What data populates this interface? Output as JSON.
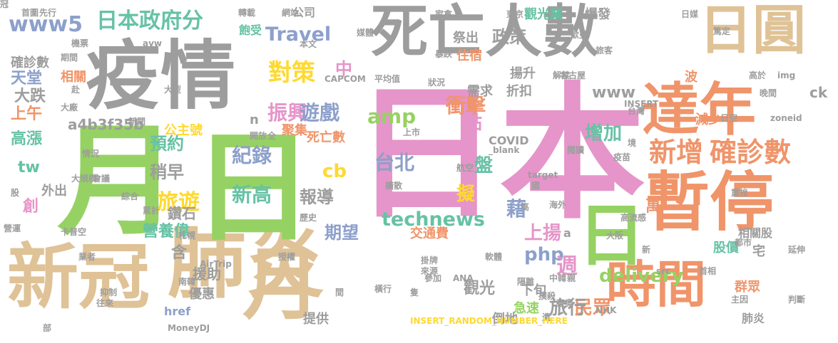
{
  "colors": {
    "tan": "#dfc296",
    "gray": "#9d9d9d",
    "green": "#96d263",
    "pink": "#e595c9",
    "orange": "#f0946a",
    "teal": "#66c2a5",
    "blue": "#8da0cb",
    "yellow": "#ffd92f"
  },
  "words": [
    {
      "text": "日本",
      "size": 1.0,
      "color": "#e595c9"
    },
    {
      "text": "肺炎",
      "size": 0.55,
      "color": "#dfc296"
    },
    {
      "text": "新冠",
      "size": 0.5,
      "color": "#dfc296"
    },
    {
      "text": "疫情",
      "size": 0.52,
      "color": "#9d9d9d"
    },
    {
      "text": "死亡人數",
      "size": 0.45,
      "color": "#9d9d9d"
    },
    {
      "text": "月",
      "size": 0.55,
      "color": "#96d263"
    },
    {
      "text": "日",
      "size": 0.55,
      "color": "#96d263"
    },
    {
      "text": "月",
      "size": 0.55,
      "color": "#dfc296"
    },
    {
      "text": "日圓",
      "size": 0.4,
      "color": "#dfc296"
    },
    {
      "text": "達年",
      "size": 0.42,
      "color": "#f0946a"
    },
    {
      "text": "暫停",
      "size": 0.45,
      "color": "#f0946a"
    },
    {
      "text": "時間",
      "size": 0.32,
      "color": "#f0946a"
    },
    {
      "text": "日",
      "size": 0.35,
      "color": "#96d263"
    },
    {
      "text": "新增",
      "size": 0.2,
      "color": "#f0946a"
    },
    {
      "text": "確診數",
      "size": 0.2,
      "color": "#f0946a"
    },
    {
      "text": "日本政府分",
      "size": 0.16,
      "color": "#66c2a5"
    },
    {
      "text": "www5",
      "size": 0.16,
      "color": "#8da0cb"
    },
    {
      "text": "Travel",
      "size": 0.15,
      "color": "#8da0cb"
    },
    {
      "text": "對策",
      "size": 0.17,
      "color": "#ffd92f"
    },
    {
      "text": "振興",
      "size": 0.14,
      "color": "#e595c9"
    },
    {
      "text": "遊戲",
      "size": 0.13,
      "color": "#8da0cb"
    },
    {
      "text": "衝擊",
      "size": 0.14,
      "color": "#f0946a"
    },
    {
      "text": "政策",
      "size": 0.12,
      "color": "#9d9d9d"
    },
    {
      "text": "amp",
      "size": 0.14,
      "color": "#96d263"
    },
    {
      "text": "台北",
      "size": 0.14,
      "color": "#8da0cb"
    },
    {
      "text": "紀錄",
      "size": 0.14,
      "color": "#8da0cb"
    },
    {
      "text": "新高",
      "size": 0.14,
      "color": "#66c2a5"
    },
    {
      "text": "cb",
      "size": 0.14,
      "color": "#ffd92f"
    },
    {
      "text": "旅遊",
      "size": 0.14,
      "color": "#ffd92f"
    },
    {
      "text": "technews",
      "size": 0.13,
      "color": "#66c2a5"
    },
    {
      "text": "php",
      "size": 0.13,
      "color": "#8da0cb"
    },
    {
      "text": "delivery",
      "size": 0.13,
      "color": "#96d263"
    },
    {
      "text": "www",
      "size": 0.12,
      "color": "#9d9d9d"
    },
    {
      "text": "天堂",
      "size": 0.1,
      "color": "#8da0cb"
    },
    {
      "text": "大跌",
      "size": 0.1,
      "color": "#9d9d9d"
    },
    {
      "text": "上午",
      "size": 0.1,
      "color": "#f0946a"
    },
    {
      "text": "高漲",
      "size": 0.1,
      "color": "#66c2a5"
    },
    {
      "text": "tw",
      "size": 0.12,
      "color": "#66c2a5"
    },
    {
      "text": "預約",
      "size": 0.11,
      "color": "#66c2a5"
    },
    {
      "text": "稍早",
      "size": 0.11,
      "color": "#9d9d9d"
    },
    {
      "text": "公主號",
      "size": 0.09,
      "color": "#ffd92f"
    },
    {
      "text": "鑽石",
      "size": 0.09,
      "color": "#9d9d9d"
    },
    {
      "text": "營養偉",
      "size": 0.1,
      "color": "#66c2a5"
    },
    {
      "text": "報導",
      "size": 0.11,
      "color": "#9d9d9d"
    },
    {
      "text": "期望",
      "size": 0.11,
      "color": "#8da0cb"
    },
    {
      "text": "點",
      "size": 0.11,
      "color": "#e595c9"
    },
    {
      "text": "盤",
      "size": 0.11,
      "color": "#66c2a5"
    },
    {
      "text": "增加",
      "size": 0.11,
      "color": "#66c2a5"
    },
    {
      "text": "上揚",
      "size": 0.11,
      "color": "#e595c9"
    },
    {
      "text": "萬",
      "size": 0.1,
      "color": "#f0946a"
    },
    {
      "text": "週",
      "size": 0.12,
      "color": "#e595c9"
    },
    {
      "text": "民眾",
      "size": 0.11,
      "color": "#f0946a"
    },
    {
      "text": "旅行",
      "size": 0.11,
      "color": "#9d9d9d"
    },
    {
      "text": "藉",
      "size": 0.1,
      "color": "#8da0cb"
    },
    {
      "text": "擬",
      "size": 0.1,
      "color": "#ffd92f"
    },
    {
      "text": "中",
      "size": 0.1,
      "color": "#e595c9"
    },
    {
      "text": "創",
      "size": 0.08,
      "color": "#e595c9"
    },
    {
      "text": "含",
      "size": 0.08,
      "color": "#9d9d9d"
    },
    {
      "text": "援助",
      "size": 0.07,
      "color": "#9d9d9d"
    },
    {
      "text": "優惠",
      "size": 0.06,
      "color": "#9d9d9d"
    },
    {
      "text": "href",
      "size": 0.06,
      "color": "#8da0cb"
    },
    {
      "text": "觀光",
      "size": 0.07,
      "color": "#9d9d9d"
    },
    {
      "text": "下旬",
      "size": 0.06,
      "color": "#9d9d9d"
    },
    {
      "text": "急速",
      "size": 0.06,
      "color": "#96d263"
    },
    {
      "text": "倒地",
      "size": 0.06,
      "color": "#9d9d9d"
    },
    {
      "text": "提供",
      "size": 0.06,
      "color": "#9d9d9d"
    },
    {
      "text": "交通費",
      "size": 0.06,
      "color": "#f0946a"
    },
    {
      "text": "公司",
      "size": 0.05,
      "color": "#9d9d9d"
    },
    {
      "text": "飽受",
      "size": 0.05,
      "color": "#66c2a5"
    },
    {
      "text": "祭出",
      "size": 0.06,
      "color": "#9d9d9d"
    },
    {
      "text": "住宿",
      "size": 0.06,
      "color": "#f0946a"
    },
    {
      "text": "需求",
      "size": 0.06,
      "color": "#9d9d9d"
    },
    {
      "text": "折扣",
      "size": 0.06,
      "color": "#9d9d9d"
    },
    {
      "text": "揚升",
      "size": 0.06,
      "color": "#9d9d9d"
    },
    {
      "text": "觀光業",
      "size": 0.06,
      "color": "#66c2a5"
    },
    {
      "text": "爆發",
      "size": 0.06,
      "color": "#9d9d9d"
    },
    {
      "text": "波",
      "size": 0.06,
      "color": "#f0946a"
    },
    {
      "text": "減少",
      "size": 0.06,
      "color": "#f0946a"
    },
    {
      "text": "股價",
      "size": 0.06,
      "color": "#66c2a5"
    },
    {
      "text": "群眾",
      "size": 0.06,
      "color": "#f0946a"
    },
    {
      "text": "肺炎",
      "size": 0.05,
      "color": "#9d9d9d"
    },
    {
      "text": "相關股",
      "size": 0.05,
      "color": "#9d9d9d"
    },
    {
      "text": "ck",
      "size": 0.06,
      "color": "#9d9d9d"
    },
    {
      "text": "宅",
      "size": 0.06,
      "color": "#9d9d9d"
    },
    {
      "text": "聚集",
      "size": 0.05,
      "color": "#f0946a"
    },
    {
      "text": "死亡數",
      "size": 0.05,
      "color": "#f0946a"
    },
    {
      "text": "COVID",
      "size": 0.05,
      "color": "#9d9d9d"
    },
    {
      "text": "a4b3f35b",
      "size": 0.06,
      "color": "#9d9d9d"
    },
    {
      "text": "n",
      "size": 0.05,
      "color": "#9d9d9d"
    },
    {
      "text": "確診數",
      "size": 0.05,
      "color": "#9d9d9d"
    },
    {
      "text": "相關",
      "size": 0.05,
      "color": "#f0946a"
    },
    {
      "text": "外出",
      "size": 0.05,
      "color": "#9d9d9d"
    },
    {
      "text": "a",
      "size": 0.05,
      "color": "#9d9d9d"
    },
    {
      "text": "首圖",
      "size": 0.03,
      "color": "#9d9d9d"
    },
    {
      "text": "先行",
      "size": 0.03,
      "color": "#9d9d9d"
    },
    {
      "text": "轉載",
      "size": 0.03,
      "color": "#9d9d9d"
    },
    {
      "text": "網站",
      "size": 0.03,
      "color": "#9d9d9d"
    },
    {
      "text": "家禽",
      "size": 0.03,
      "color": "#9d9d9d"
    },
    {
      "text": "東京",
      "size": 0.03,
      "color": "#9d9d9d"
    },
    {
      "text": "日媒",
      "size": 0.03,
      "color": "#9d9d9d"
    },
    {
      "text": "機票",
      "size": 0.03,
      "color": "#9d9d9d"
    },
    {
      "text": "期間",
      "size": 0.03,
      "color": "#9d9d9d"
    },
    {
      "text": "avw",
      "size": 0.03,
      "color": "#9d9d9d"
    },
    {
      "text": "本文",
      "size": 0.03,
      "color": "#9d9d9d"
    },
    {
      "text": "媒體",
      "size": 0.03,
      "color": "#9d9d9d"
    },
    {
      "text": "暴跌",
      "size": 0.03,
      "color": "#9d9d9d"
    },
    {
      "text": "歐亞",
      "size": 0.03,
      "color": "#9d9d9d"
    },
    {
      "text": "篤定",
      "size": 0.03,
      "color": "#9d9d9d"
    },
    {
      "text": "旅客",
      "size": 0.03,
      "color": "#9d9d9d"
    },
    {
      "text": "赴",
      "size": 0.03,
      "color": "#9d9d9d"
    },
    {
      "text": "大型",
      "size": 0.03,
      "color": "#9d9d9d"
    },
    {
      "text": "大廠",
      "size": 0.03,
      "color": "#9d9d9d"
    },
    {
      "text": "新聞",
      "size": 0.03,
      "color": "#9d9d9d"
    },
    {
      "text": "CAPCOM",
      "size": 0.03,
      "color": "#9d9d9d"
    },
    {
      "text": "平均值",
      "size": 0.03,
      "color": "#9d9d9d"
    },
    {
      "text": "狀況",
      "size": 0.03,
      "color": "#9d9d9d"
    },
    {
      "text": "解禁",
      "size": 0.03,
      "color": "#9d9d9d"
    },
    {
      "text": "名古屋",
      "size": 0.03,
      "color": "#9d9d9d"
    },
    {
      "text": "高於",
      "size": 0.03,
      "color": "#9d9d9d"
    },
    {
      "text": "img",
      "size": 0.03,
      "color": "#9d9d9d"
    },
    {
      "text": "晚間",
      "size": 0.03,
      "color": "#9d9d9d"
    },
    {
      "text": "INSERT",
      "size": 0.03,
      "color": "#9d9d9d"
    },
    {
      "text": "台灣",
      "size": 0.03,
      "color": "#9d9d9d"
    },
    {
      "text": "日空",
      "size": 0.03,
      "color": "#9d9d9d"
    },
    {
      "text": "zoneid",
      "size": 0.03,
      "color": "#9d9d9d"
    },
    {
      "text": "開放",
      "size": 0.03,
      "color": "#9d9d9d"
    },
    {
      "text": "全",
      "size": 0.03,
      "color": "#9d9d9d"
    },
    {
      "text": "上市",
      "size": 0.03,
      "color": "#9d9d9d"
    },
    {
      "text": "_blank",
      "size": 0.03,
      "color": "#9d9d9d"
    },
    {
      "text": "閱讀",
      "size": 0.03,
      "color": "#9d9d9d"
    },
    {
      "text": "疫苗",
      "size": 0.03,
      "color": "#9d9d9d"
    },
    {
      "text": "情況",
      "size": 0.03,
      "color": "#9d9d9d"
    },
    {
      "text": "綜合",
      "size": 0.03,
      "color": "#9d9d9d"
    },
    {
      "text": "航空",
      "size": 0.03,
      "color": "#9d9d9d"
    },
    {
      "text": "大規模",
      "size": 0.03,
      "color": "#9d9d9d"
    },
    {
      "text": "會議",
      "size": 0.03,
      "color": "#9d9d9d"
    },
    {
      "text": "擴散",
      "size": 0.03,
      "color": "#9d9d9d"
    },
    {
      "text": "target",
      "size": 0.03,
      "color": "#9d9d9d"
    },
    {
      "text": "境",
      "size": 0.03,
      "color": "#9d9d9d"
    },
    {
      "text": "股",
      "size": 0.03,
      "color": "#9d9d9d"
    },
    {
      "text": "國",
      "size": 0.03,
      "color": "#9d9d9d"
    },
    {
      "text": "重挫",
      "size": 0.03,
      "color": "#9d9d9d"
    },
    {
      "text": "累計",
      "size": 0.03,
      "color": "#9d9d9d"
    },
    {
      "text": "高",
      "size": 0.03,
      "color": "#9d9d9d"
    },
    {
      "text": "海外",
      "size": 0.03,
      "color": "#9d9d9d"
    },
    {
      "text": "高流感",
      "size": 0.03,
      "color": "#9d9d9d"
    },
    {
      "text": "營運",
      "size": 0.03,
      "color": "#9d9d9d"
    },
    {
      "text": "卡普空",
      "size": 0.03,
      "color": "#9d9d9d"
    },
    {
      "text": "札幌",
      "size": 0.03,
      "color": "#9d9d9d"
    },
    {
      "text": "歷史",
      "size": 0.03,
      "color": "#9d9d9d"
    },
    {
      "text": "新",
      "size": 0.03,
      "color": "#9d9d9d"
    },
    {
      "text": "都市",
      "size": 0.03,
      "color": "#9d9d9d"
    },
    {
      "text": "延伸",
      "size": 0.03,
      "color": "#9d9d9d"
    },
    {
      "text": "大阪",
      "size": 0.03,
      "color": "#9d9d9d"
    },
    {
      "text": "業者",
      "size": 0.03,
      "color": "#9d9d9d"
    },
    {
      "text": "AirTrip",
      "size": 0.03,
      "color": "#9d9d9d"
    },
    {
      "text": "授權",
      "size": 0.03,
      "color": "#9d9d9d"
    },
    {
      "text": "軟體",
      "size": 0.03,
      "color": "#9d9d9d"
    },
    {
      "text": "src",
      "size": 0.03,
      "color": "#9d9d9d"
    },
    {
      "text": "首相",
      "size": 0.03,
      "color": "#9d9d9d"
    },
    {
      "text": "南韓",
      "size": 0.03,
      "color": "#9d9d9d"
    },
    {
      "text": "掛牌",
      "size": 0.03,
      "color": "#9d9d9d"
    },
    {
      "text": "來源",
      "size": 0.03,
      "color": "#9d9d9d"
    },
    {
      "text": "參加",
      "size": 0.03,
      "color": "#9d9d9d"
    },
    {
      "text": "ANA",
      "size": 0.03,
      "color": "#9d9d9d"
    },
    {
      "text": "隔離",
      "size": 0.03,
      "color": "#9d9d9d"
    },
    {
      "text": "中韓",
      "size": 0.03,
      "color": "#9d9d9d"
    },
    {
      "text": "親",
      "size": 0.03,
      "color": "#9d9d9d"
    },
    {
      "text": "撲殺",
      "size": 0.03,
      "color": "#9d9d9d"
    },
    {
      "text": "主因",
      "size": 0.03,
      "color": "#9d9d9d"
    },
    {
      "text": "判斷",
      "size": 0.03,
      "color": "#9d9d9d"
    },
    {
      "text": "抑制",
      "size": 0.03,
      "color": "#9d9d9d"
    },
    {
      "text": "往來",
      "size": 0.03,
      "color": "#9d9d9d"
    },
    {
      "text": "橫行",
      "size": 0.03,
      "color": "#9d9d9d"
    },
    {
      "text": "隻",
      "size": 0.03,
      "color": "#9d9d9d"
    },
    {
      "text": "東奧",
      "size": 0.03,
      "color": "#9d9d9d"
    },
    {
      "text": "NHK",
      "size": 0.03,
      "color": "#9d9d9d"
    },
    {
      "text": "遺",
      "size": 0.03,
      "color": "#9d9d9d"
    },
    {
      "text": "部",
      "size": 0.03,
      "color": "#9d9d9d"
    },
    {
      "text": "MoneyDJ",
      "size": 0.03,
      "color": "#9d9d9d"
    },
    {
      "text": "INSERT_RANDOM_NUMBER_HERE",
      "size": 0.03,
      "color": "#ffd92f"
    },
    {
      "text": "間",
      "size": 0.03,
      "color": "#9d9d9d"
    },
    {
      "text": "冠",
      "size": 0.03,
      "color": "#9d9d9d"
    }
  ]
}
